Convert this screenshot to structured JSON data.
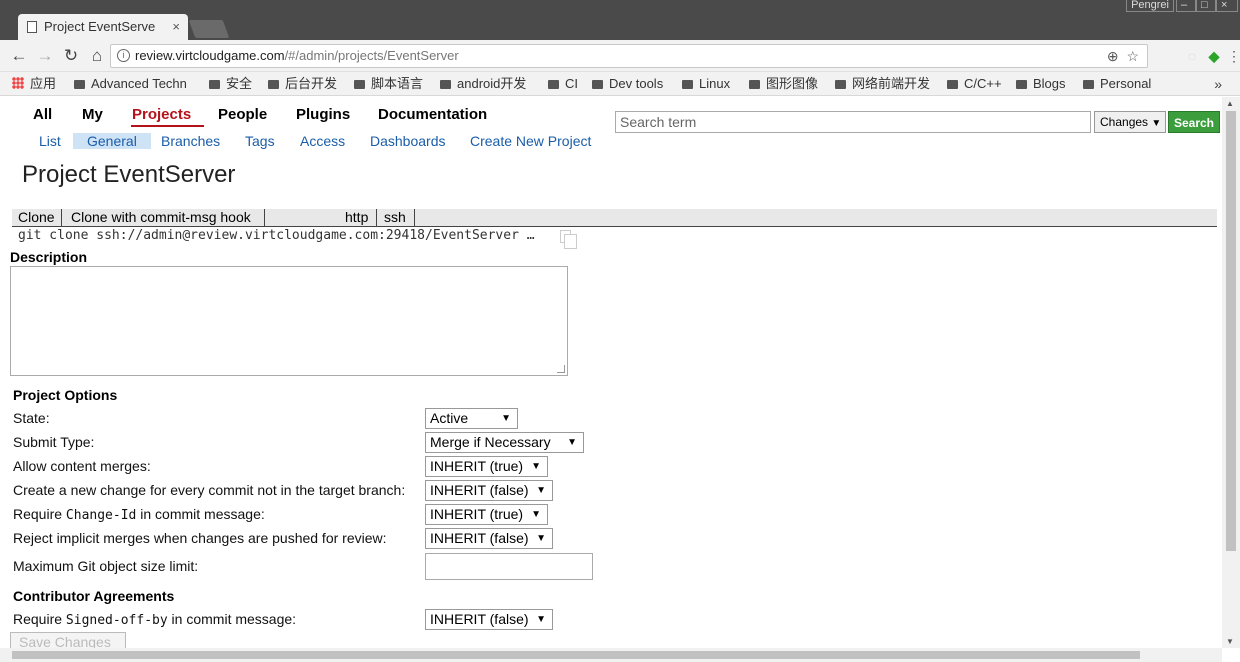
{
  "browser": {
    "tab_title": "Project EventServe",
    "tab_close": "×",
    "user_label": "Pengrei",
    "url_host": "review.virtcloudgame.com",
    "url_path": "/#/admin/projects/EventServer",
    "zoom_icon": "zoom-icon",
    "star_icon": "star-icon"
  },
  "bookmarks": [
    {
      "label": "应用",
      "icon": "apps-icon"
    },
    {
      "label": "Advanced Techn",
      "icon": "folder-icon"
    },
    {
      "label": "安全",
      "icon": "folder-icon"
    },
    {
      "label": "后台开发",
      "icon": "folder-icon"
    },
    {
      "label": "脚本语言",
      "icon": "folder-icon"
    },
    {
      "label": "android开发",
      "icon": "folder-icon"
    },
    {
      "label": "CI",
      "icon": "folder-icon"
    },
    {
      "label": "Dev tools",
      "icon": "folder-icon"
    },
    {
      "label": "Linux",
      "icon": "folder-icon"
    },
    {
      "label": "图形图像",
      "icon": "folder-icon"
    },
    {
      "label": "网络前端开发",
      "icon": "folder-icon"
    },
    {
      "label": "C/C++",
      "icon": "folder-icon"
    },
    {
      "label": "Blogs",
      "icon": "folder-icon"
    },
    {
      "label": "Personal",
      "icon": "folder-icon"
    }
  ],
  "bookmarks_more": "»",
  "topmenu": [
    "All",
    "My",
    "Projects",
    "People",
    "Plugins",
    "Documentation"
  ],
  "submenu": [
    "List",
    "General",
    "Branches",
    "Tags",
    "Access",
    "Dashboards",
    "Create New Project"
  ],
  "search": {
    "placeholder": "Search term",
    "scope": "Changes",
    "button": "Search"
  },
  "page_title": "Project EventServer",
  "clone": {
    "tabs": [
      "Clone",
      "Clone with commit-msg hook",
      "http",
      "ssh"
    ],
    "command": "git clone ssh://admin@review.virtcloudgame.com:29418/EventServer …"
  },
  "description_label": "Description",
  "project_options": {
    "heading": "Project Options",
    "rows": [
      {
        "label": "State:",
        "value": "Active"
      },
      {
        "label": "Submit Type:",
        "value": "Merge if Necessary"
      },
      {
        "label": "Allow content merges:",
        "value": "INHERIT (true)"
      },
      {
        "label": "Create a new change for every commit not in the target branch:",
        "value": "INHERIT (false)"
      },
      {
        "label_pre": "Require ",
        "label_code": "Change-Id",
        "label_post": " in commit message:",
        "value": "INHERIT (true)"
      },
      {
        "label": "Reject implicit merges when changes are pushed for review:",
        "value": "INHERIT (false)"
      },
      {
        "label": "Maximum Git object size limit:",
        "value": ""
      }
    ]
  },
  "contributor_agreements": {
    "heading": "Contributor Agreements",
    "label_pre": "Require ",
    "label_code": "Signed-off-by",
    "label_post": " in commit message:",
    "value": "INHERIT (false)"
  },
  "save_button": "Save Changes",
  "dropdown_arrow": "▼",
  "colors": {
    "active_menu": "#b5121b",
    "link": "#1a5da8",
    "search_button": "#3b9d3b"
  }
}
